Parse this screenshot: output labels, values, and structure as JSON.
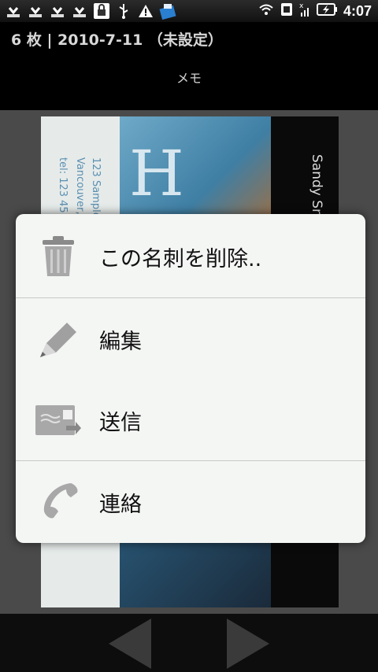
{
  "status_bar": {
    "time": "4:07",
    "left_icons": [
      "download-done-icon",
      "download-done-icon",
      "download-done-icon",
      "download-done-icon",
      "lock-bag-icon",
      "usb-icon",
      "warning-icon",
      "app-icon"
    ],
    "right_icons": [
      "wifi-icon",
      "sim-icon",
      "signal-icon",
      "battery-charging-icon"
    ]
  },
  "header": {
    "title": "6 枚 | 2010-7-11 （未設定）",
    "memo_label": "メモ"
  },
  "card": {
    "address_line1": "123 Sample",
    "address_line2": "Vancouver,",
    "tel_line": "tel: 123 45",
    "name": "Sandy Sn",
    "big_letter": "H"
  },
  "context_menu": {
    "items": [
      {
        "label": "この名刺を削除..",
        "icon": "trash-icon"
      },
      {
        "label": "編集",
        "icon": "pencil-icon"
      },
      {
        "label": "送信",
        "icon": "send-card-icon"
      },
      {
        "label": "連絡",
        "icon": "phone-icon"
      }
    ]
  },
  "colors": {
    "menu_bg": "#f4f6f4",
    "divider": "#c8cac8",
    "icon_gray": "#9a9a9a"
  }
}
